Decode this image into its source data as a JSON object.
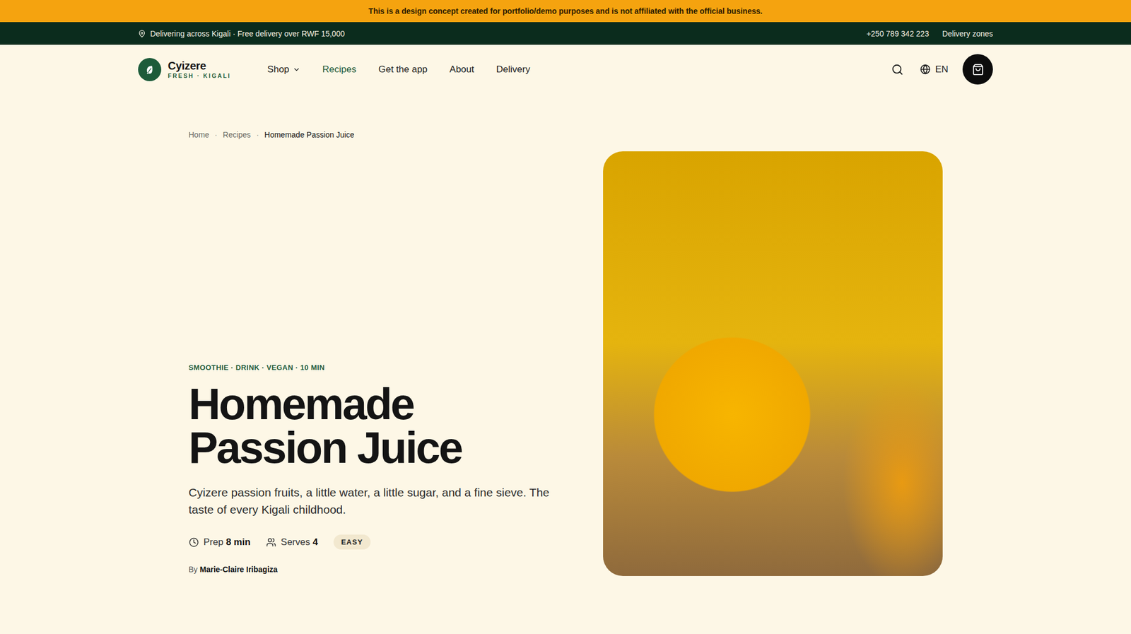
{
  "banner": {
    "text": "This is a design concept created for portfolio/demo purposes and is not affiliated with the official business."
  },
  "topbar": {
    "location": "Delivering across Kigali · Free delivery over RWF 15,000",
    "phone": "+250 789 342 223",
    "link": "Delivery zones"
  },
  "brand": {
    "name": "Cyizere",
    "tagline": "FRESH · KIGALI"
  },
  "nav": {
    "items": [
      {
        "label": "Shop",
        "selected": false,
        "dropdown": true
      },
      {
        "label": "Recipes",
        "selected": true,
        "dropdown": false
      },
      {
        "label": "Get the app",
        "selected": false,
        "dropdown": false
      },
      {
        "label": "About",
        "selected": false,
        "dropdown": false
      },
      {
        "label": "Delivery",
        "selected": false,
        "dropdown": false
      }
    ],
    "language": "EN"
  },
  "breadcrumb": {
    "separator": "·",
    "items": [
      {
        "label": "Home",
        "current": false
      },
      {
        "label": "Recipes",
        "current": false
      },
      {
        "label": "Homemade Passion Juice",
        "current": true
      }
    ]
  },
  "recipe": {
    "tags": "SMOOTHIE · DRINK · VEGAN · 10 MIN",
    "title": "Homemade Passion Juice",
    "description": "Cyizere passion fruits, a little water, a little sugar, and a fine sieve. The taste of every Kigali childhood.",
    "prep_label": "Prep",
    "prep_value": "8 min",
    "serves_label": "Serves",
    "serves_value": "4",
    "difficulty": "EASY",
    "author_prefix": "By",
    "author": "Marie-Claire Iribagiza"
  }
}
